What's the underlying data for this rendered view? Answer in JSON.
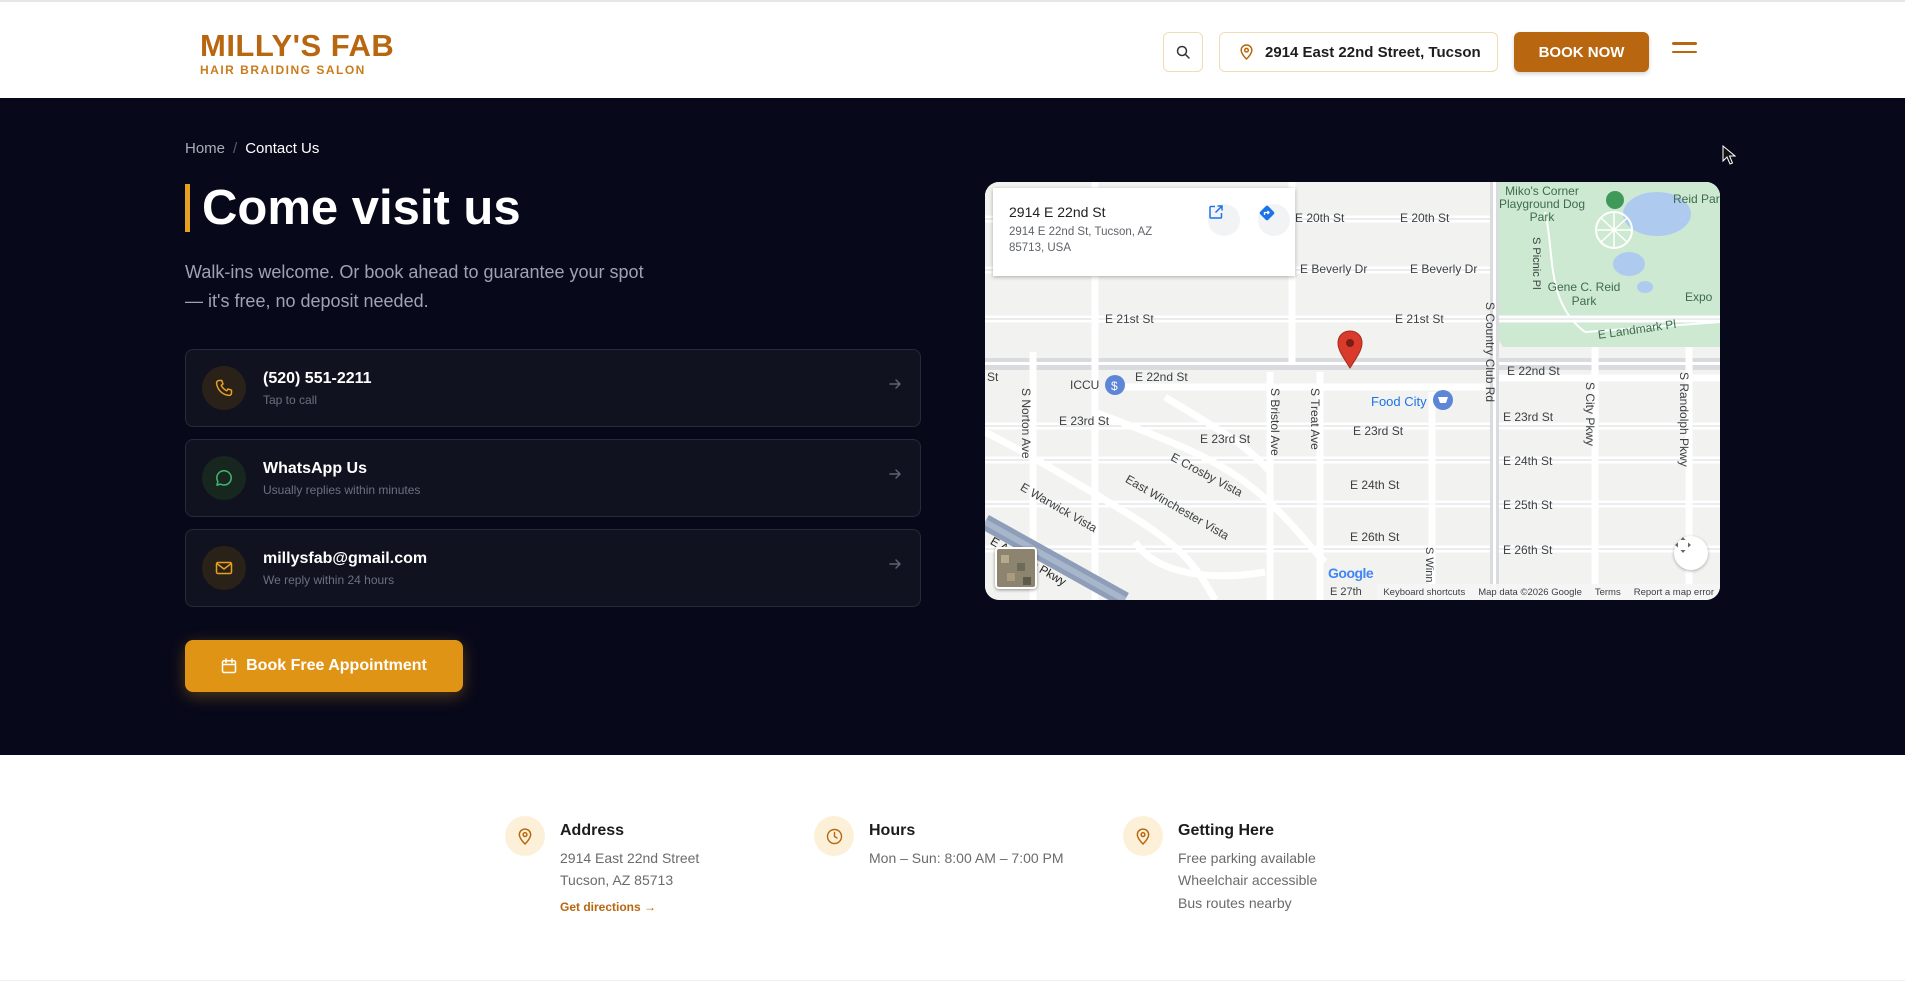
{
  "header": {
    "logo_title": "MILLY'S FAB",
    "logo_subtitle": "HAIR BRAIDING SALON",
    "address_button": "2914 East 22nd Street, Tucson",
    "book_now": "BOOK NOW",
    "accent": "#b8660f"
  },
  "hero": {
    "breadcrumb": {
      "home": "Home",
      "separator": "/",
      "current": "Contact Us"
    },
    "title": "Come visit us",
    "description": "Walk-ins welcome. Or book ahead to guarantee your spot — it's free, no deposit needed.",
    "cards": [
      {
        "title": "(520) 551-2211",
        "subtitle": "Tap to call",
        "icon": "phone-icon"
      },
      {
        "title": "WhatsApp Us",
        "subtitle": "Usually replies within minutes",
        "icon": "whatsapp-icon"
      },
      {
        "title": "millysfab@gmail.com",
        "subtitle": "We reply within 24 hours",
        "icon": "mail-icon"
      }
    ],
    "book_button": "Book Free Appointment",
    "background": "#07081a"
  },
  "map": {
    "place_title": "2914 E 22nd St",
    "place_address": "2914 E 22nd St, Tucson, AZ 85713, USA",
    "labels": {
      "e20th_a": "E 20th St",
      "e20th_b": "E 20th St",
      "beverly_a": "E Beverly Dr",
      "beverly_b": "E Beverly Dr",
      "e21st_a": "E 21st St",
      "e21st_b": "E 21st St",
      "e22nd_a": "E 22nd St",
      "e22nd_b": "E 22nd St",
      "st_left": "St",
      "iccu": "ICCU",
      "food_city": "Food City",
      "e23rd_a": "E 23rd St",
      "e23rd_b": "E 23rd St",
      "e23rd_c": "E 23rd St",
      "e23rd_d": "E 23rd St",
      "crosby": "E Crosby Vista",
      "winchester": "East Winchester Vista",
      "warwick": "E Warwick Vista",
      "aviation": "E Aviation Pkwy",
      "e24th_a": "E 24th St",
      "e24th_b": "E 24th St",
      "e25th": "E 25th St",
      "e26th_a": "E 26th St",
      "e26th_b": "E 26th St",
      "e27th": "E 27th",
      "norton": "S Norton Ave",
      "bristol": "S Bristol Ave",
      "treat": "S Treat Ave",
      "country_club": "S Country Club Rd",
      "city_pkwy": "S City Pkwy",
      "randolph": "S Randolph Pkwy",
      "picnic": "S Picnic Pl",
      "winn": "S Winn",
      "mikos": "Miko's Corner Playground Dog Park",
      "reid_park_top": "Reid Par",
      "gene_reid": "Gene C. Reid Park",
      "expo": "Expo",
      "landmark": "E Landmark Pl"
    },
    "google": "Google",
    "attribution": [
      "Keyboard shortcuts",
      "Map data ©2026 Google",
      "Terms",
      "Report a map error"
    ],
    "marker_color": "#d93a2b"
  },
  "info": [
    {
      "title": "Address",
      "lines": [
        "2914 East 22nd Street",
        "Tucson, AZ 85713"
      ],
      "link": "Get directions →",
      "icon": "map-pin-icon"
    },
    {
      "title": "Hours",
      "lines": [
        "Mon – Sun: 8:00 AM – 7:00 PM"
      ],
      "icon": "clock-icon"
    },
    {
      "title": "Getting Here",
      "lines": [
        "Free parking available",
        "Wheelchair accessible",
        "Bus routes nearby"
      ],
      "icon": "map-pin-icon"
    }
  ]
}
